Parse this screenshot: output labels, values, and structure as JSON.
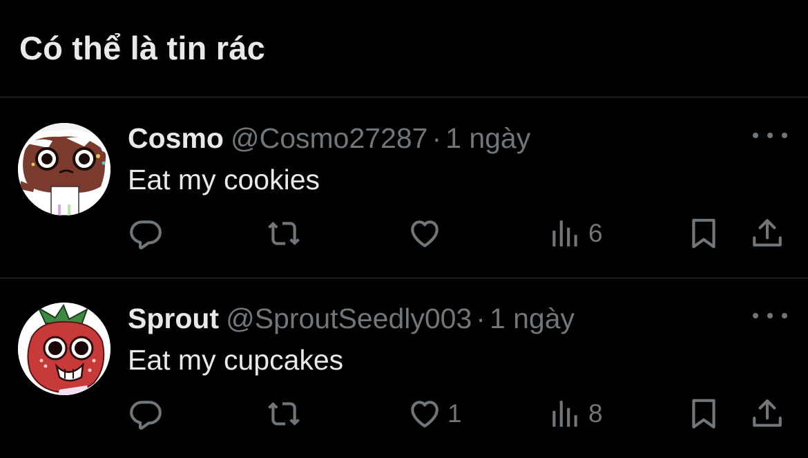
{
  "section": {
    "title": "Có thể là tin rác"
  },
  "tweets": [
    {
      "display_name": "Cosmo",
      "handle": "@Cosmo27287",
      "separator": "·",
      "time": "1 ngày",
      "text": "Eat my cookies",
      "replies": "",
      "retweets": "",
      "likes": "",
      "views": "6",
      "avatar_icon": "cookie-character-avatar"
    },
    {
      "display_name": "Sprout",
      "handle": "@SproutSeedly003",
      "separator": "·",
      "time": "1 ngày",
      "text": "Eat my cupcakes",
      "replies": "",
      "retweets": "",
      "likes": "1",
      "views": "8",
      "avatar_icon": "strawberry-character-avatar"
    }
  ],
  "colors": {
    "background": "#000000",
    "primary_text": "#e7e9ea",
    "secondary_text": "#71767b",
    "divider": "#2f3336"
  },
  "icons": {
    "reply": "reply-icon",
    "retweet": "retweet-icon",
    "like": "heart-icon",
    "views": "views-icon",
    "bookmark": "bookmark-icon",
    "share": "share-icon",
    "more": "more-icon"
  }
}
